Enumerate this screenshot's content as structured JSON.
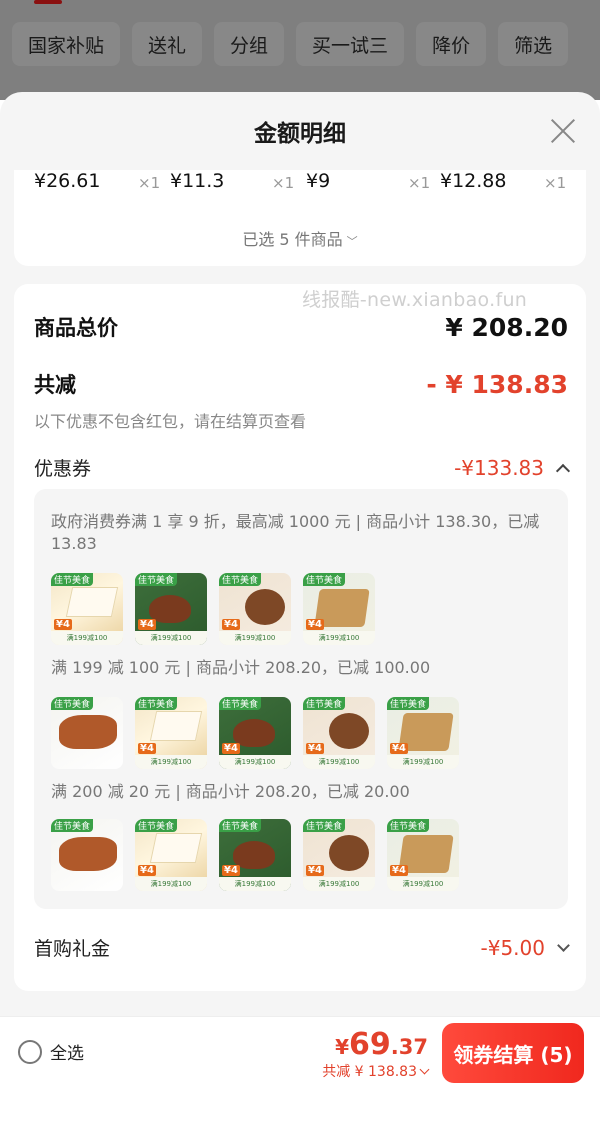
{
  "background": {
    "filters": [
      "国家补贴",
      "送礼",
      "分组",
      "买一试三",
      "降价",
      "筛选"
    ]
  },
  "sheet": {
    "title": "金额明细",
    "items": [
      {
        "price": "¥26.61",
        "qty": "×1"
      },
      {
        "price": "¥11.3",
        "qty": "×1"
      },
      {
        "price": "¥9",
        "qty": "×1"
      },
      {
        "price": "¥12.88",
        "qty": "×1"
      }
    ],
    "selected_text": "已选 5 件商品"
  },
  "watermark": "线报酷-new.xianbao.fun",
  "summary": {
    "total_label": "商品总价",
    "total_value": "¥ 208.20",
    "reduce_label": "共减",
    "reduce_value": "- ¥ 138.83",
    "note": "以下优惠不包含红包，请在结算页查看"
  },
  "coupons": {
    "label": "优惠券",
    "value": "-¥133.83",
    "groups": [
      {
        "desc": "政府消费券满 1 享 9 折，最高减 1000 元 | 商品小计 138.30，已减 13.83"
      },
      {
        "desc": "满 199 减 100 元 | 商品小计 208.20，已减 100.00"
      },
      {
        "desc": "满 200 减 20 元 | 商品小计 208.20，已减 20.00"
      }
    ],
    "thumb_texts": {
      "badge": "佳节美食",
      "strip": "满199减100",
      "tag": "¥4"
    }
  },
  "gift": {
    "label": "首购礼金",
    "value": "-¥5.00"
  },
  "bottom": {
    "select_all": "全选",
    "price_currency": "¥",
    "price_int": "69",
    "price_dec": ".37",
    "total_reduce": "共减 ¥ 138.83",
    "checkout": "领券结算 (5)"
  },
  "colors": {
    "accent": "#e2422c",
    "button": "#f0281e"
  }
}
